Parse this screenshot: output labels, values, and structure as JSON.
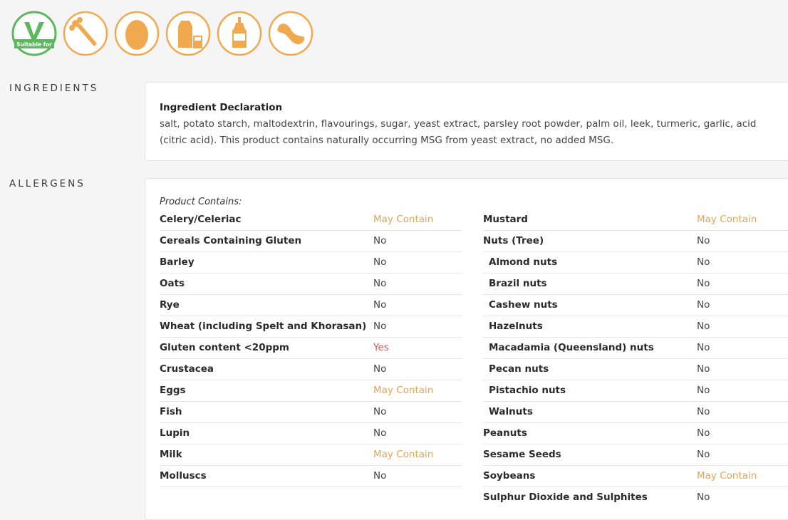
{
  "badges": {
    "vegetarian_label": "Suitable for",
    "colors": {
      "green": "#5cb85c",
      "orange": "#f0a94e"
    },
    "icons": [
      "vegetarian-icon",
      "celery-icon",
      "egg-icon",
      "milk-icon",
      "mustard-icon",
      "soybean-icon"
    ]
  },
  "ingredients": {
    "section_label": "INGREDIENTS",
    "title": "Ingredient Declaration",
    "text": "salt, potato starch, maltodextrin, flavourings, sugar, yeast extract, parsley root powder, palm oil, leek, turmeric, garlic, acid (citric acid). This product contains naturally occurring MSG from yeast extract, no added MSG."
  },
  "allergens": {
    "section_label": "ALLERGENS",
    "contains_label": "Product Contains:",
    "left": [
      {
        "name": "Celery/Celeriac",
        "value": "May Contain",
        "status": "may"
      },
      {
        "name": "Cereals Containing Gluten",
        "value": "No",
        "status": "no"
      },
      {
        "name": "Barley",
        "value": "No",
        "status": "no"
      },
      {
        "name": "Oats",
        "value": "No",
        "status": "no"
      },
      {
        "name": "Rye",
        "value": "No",
        "status": "no"
      },
      {
        "name": "Wheat (including Spelt and Khorasan)",
        "value": "No",
        "status": "no"
      },
      {
        "name": "Gluten content <20ppm",
        "value": "Yes",
        "status": "yes"
      },
      {
        "name": "Crustacea",
        "value": "No",
        "status": "no"
      },
      {
        "name": "Eggs",
        "value": "May Contain",
        "status": "may"
      },
      {
        "name": "Fish",
        "value": "No",
        "status": "no"
      },
      {
        "name": "Lupin",
        "value": "No",
        "status": "no"
      },
      {
        "name": "Milk",
        "value": "May Contain",
        "status": "may"
      },
      {
        "name": "Molluscs",
        "value": "No",
        "status": "no"
      }
    ],
    "right": [
      {
        "name": "Mustard",
        "value": "May Contain",
        "status": "may"
      },
      {
        "name": "Nuts (Tree)",
        "value": "No",
        "status": "no"
      },
      {
        "name": "Almond nuts",
        "value": "No",
        "status": "no",
        "sub": true
      },
      {
        "name": "Brazil nuts",
        "value": "No",
        "status": "no",
        "sub": true
      },
      {
        "name": "Cashew nuts",
        "value": "No",
        "status": "no",
        "sub": true
      },
      {
        "name": "Hazelnuts",
        "value": "No",
        "status": "no",
        "sub": true
      },
      {
        "name": "Macadamia (Queensland) nuts",
        "value": "No",
        "status": "no",
        "sub": true
      },
      {
        "name": "Pecan nuts",
        "value": "No",
        "status": "no",
        "sub": true
      },
      {
        "name": "Pistachio nuts",
        "value": "No",
        "status": "no",
        "sub": true
      },
      {
        "name": "Walnuts",
        "value": "No",
        "status": "no",
        "sub": true
      },
      {
        "name": "Peanuts",
        "value": "No",
        "status": "no"
      },
      {
        "name": "Sesame Seeds",
        "value": "No",
        "status": "no"
      },
      {
        "name": "Soybeans",
        "value": "May Contain",
        "status": "may"
      },
      {
        "name": "Sulphur Dioxide and Sulphites",
        "value": "No",
        "status": "no"
      }
    ]
  }
}
